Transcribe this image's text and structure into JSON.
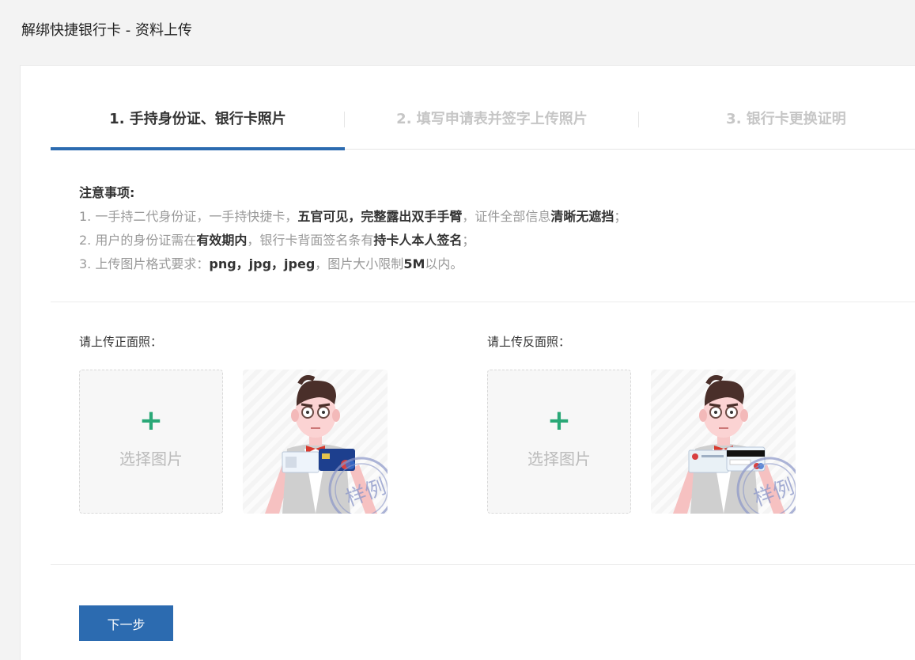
{
  "page": {
    "title": "解绑快捷银行卡 - 资料上传"
  },
  "steps": [
    {
      "label": "1. 手持身份证、银行卡照片",
      "active": true
    },
    {
      "label": "2. 填写申请表并签字上传照片",
      "active": false
    },
    {
      "label": "3. 银行卡更换证明",
      "active": false
    }
  ],
  "notes": {
    "title": "注意事项:",
    "line1": {
      "a": "1. 一手持二代身份证，一手持快捷卡，",
      "b": "五官可见，完整露出双手手臂",
      "c": "，证件全部信息",
      "d": "清晰无遮挡",
      "e": "；"
    },
    "line2": {
      "a": "2. 用户的身份证需在",
      "b": "有效期内",
      "c": "，银行卡背面签名条有",
      "d": "持卡人本人签名",
      "e": "；"
    },
    "line3": {
      "a": "3. 上传图片格式要求：",
      "b": "png，jpg，jpeg",
      "c": "，图片大小限制",
      "d": "5M",
      "e": "以内。"
    }
  },
  "upload": {
    "front": {
      "label": "请上传正面照：",
      "button_text": "选择图片",
      "sample_watermark": "样例"
    },
    "back": {
      "label": "请上传反面照：",
      "button_text": "选择图片",
      "sample_watermark": "样例"
    }
  },
  "next_button": "下一步",
  "colors": {
    "accent": "#2c6bb0",
    "plus": "#2aa877",
    "watermark": "#8a96c8"
  }
}
